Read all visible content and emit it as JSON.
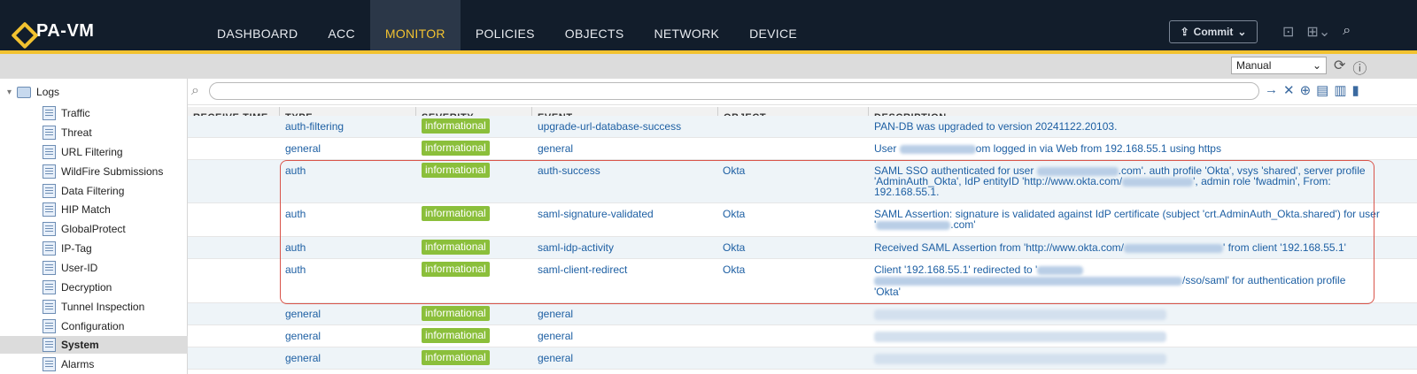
{
  "app": {
    "title": "PA-VM"
  },
  "nav": [
    {
      "label": "DASHBOARD",
      "active": false
    },
    {
      "label": "ACC",
      "active": false
    },
    {
      "label": "MONITOR",
      "active": true
    },
    {
      "label": "POLICIES",
      "active": false
    },
    {
      "label": "OBJECTS",
      "active": false
    },
    {
      "label": "NETWORK",
      "active": false
    },
    {
      "label": "DEVICE",
      "active": false
    }
  ],
  "header": {
    "commit_label": "Commit"
  },
  "toolbar": {
    "refresh_mode": "Manual"
  },
  "sidebar": {
    "root_label": "Logs",
    "items": [
      {
        "label": "Traffic"
      },
      {
        "label": "Threat"
      },
      {
        "label": "URL Filtering"
      },
      {
        "label": "WildFire Submissions"
      },
      {
        "label": "Data Filtering"
      },
      {
        "label": "HIP Match"
      },
      {
        "label": "GlobalProtect"
      },
      {
        "label": "IP-Tag"
      },
      {
        "label": "User-ID"
      },
      {
        "label": "Decryption"
      },
      {
        "label": "Tunnel Inspection"
      },
      {
        "label": "Configuration"
      },
      {
        "label": "System",
        "active": true
      },
      {
        "label": "Alarms"
      }
    ]
  },
  "filter": {
    "placeholder": ""
  },
  "table": {
    "columns": [
      "RECEIVE TIME",
      "TYPE",
      "SEVERITY",
      "EVENT",
      "OBJECT",
      "DESCRIPTION"
    ],
    "rows": [
      {
        "type": "auth-filtering",
        "severity": "informational",
        "event": "upgrade-url-database-success",
        "object": "",
        "desc1": "PAN-DB was upgraded to version 20241122.20103.",
        "desc2": "",
        "desc3": ""
      },
      {
        "type": "general",
        "severity": "informational",
        "event": "general",
        "object": "",
        "desc1": "User ",
        "desc1b": "om logged in via Web from 192.168.55.1 using https",
        "desc2": "",
        "desc3": ""
      },
      {
        "type": "auth",
        "severity": "informational",
        "event": "auth-success",
        "object": "Okta",
        "desc1": "SAML SSO authenticated for user ",
        "desc1b": ".com'. auth profile 'Okta', vsys 'shared', server profile",
        "desc2": "'AdminAuth_Okta', IdP entityID 'http://www.okta.com/",
        "desc2b": "', admin role 'fwadmin', From:",
        "desc3": "192.168.55.1."
      },
      {
        "type": "auth",
        "severity": "informational",
        "event": "saml-signature-validated",
        "object": "Okta",
        "desc1": "SAML Assertion: signature is validated against IdP certificate (subject 'crt.AdminAuth_Okta.shared') for user",
        "desc2": "'",
        "desc2b": ".com'",
        "desc3": ""
      },
      {
        "type": "auth",
        "severity": "informational",
        "event": "saml-idp-activity",
        "object": "Okta",
        "desc1": "Received SAML Assertion from 'http://www.okta.com/",
        "desc1b": "' from client '192.168.55.1'",
        "desc2": "",
        "desc3": ""
      },
      {
        "type": "auth",
        "severity": "informational",
        "event": "saml-client-redirect",
        "object": "Okta",
        "desc1": "Client '192.168.55.1' redirected to '",
        "desc2": "",
        "desc2b": "/sso/saml' for authentication profile",
        "desc3": "'Okta'"
      },
      {
        "type": "general",
        "severity": "informational",
        "event": "general",
        "object": "",
        "desc1": "",
        "desc2": "",
        "desc3": ""
      },
      {
        "type": "general",
        "severity": "informational",
        "event": "general",
        "object": "",
        "desc1": "",
        "desc2": "",
        "desc3": ""
      },
      {
        "type": "general",
        "severity": "informational",
        "event": "general",
        "object": "",
        "desc1": "",
        "desc2": "",
        "desc3": ""
      }
    ]
  },
  "colors": {
    "topbar": "#121d2b",
    "accent": "#f2c230",
    "badge": "#8bbf3b",
    "link": "#1d5fa3",
    "highlight": "#d9544a"
  }
}
